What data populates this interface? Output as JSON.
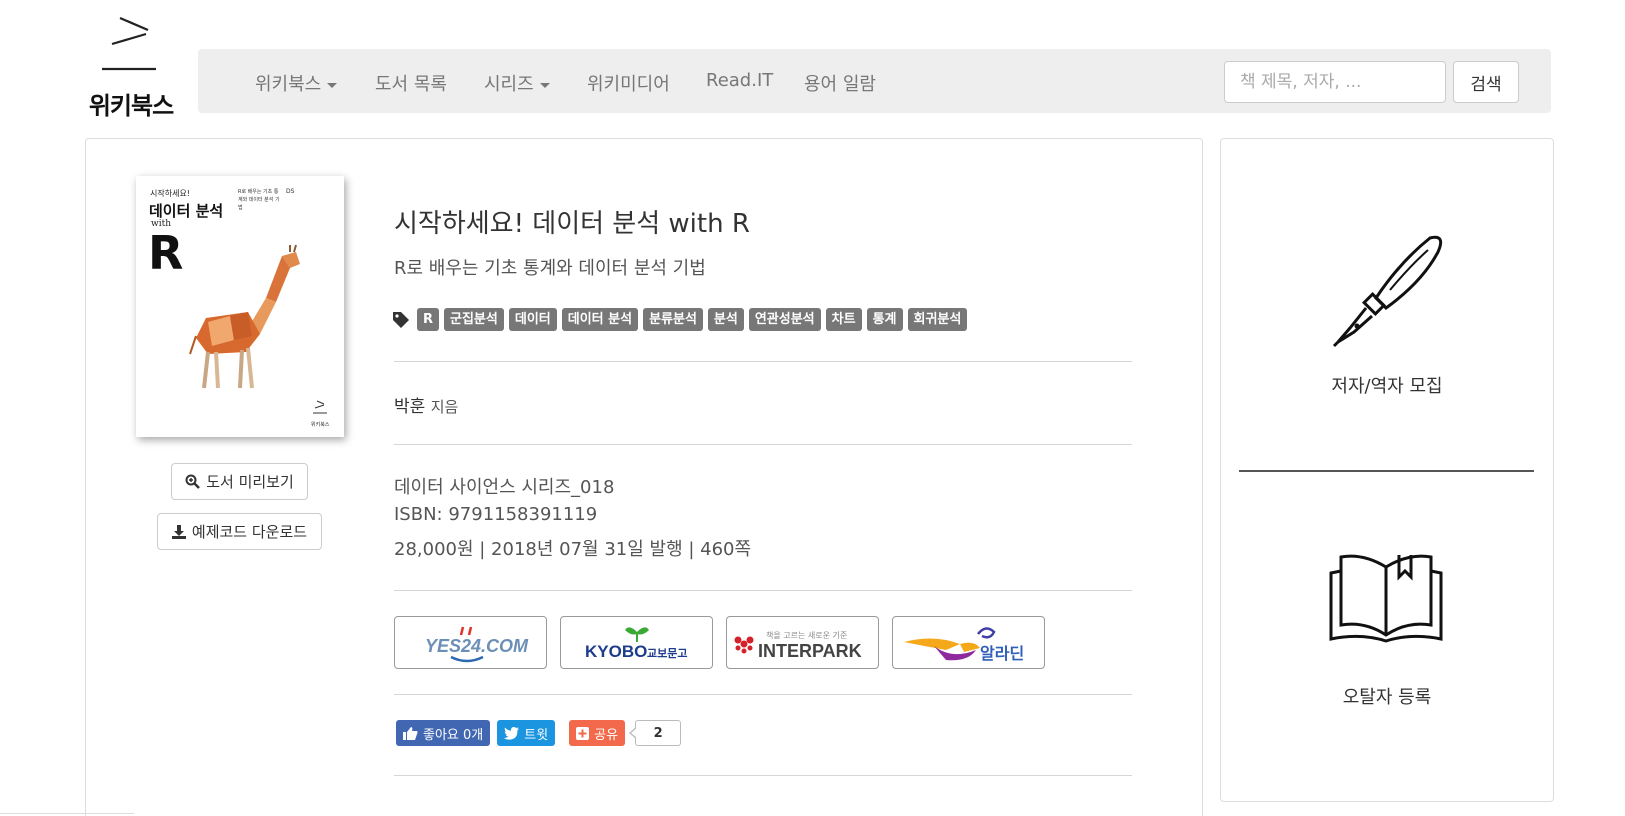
{
  "logo": {
    "text": "위키북스"
  },
  "nav": {
    "items": [
      {
        "label": "위키북스",
        "has_caret": true
      },
      {
        "label": "도서 목록",
        "has_caret": false
      },
      {
        "label": "시리즈",
        "has_caret": true
      },
      {
        "label": "위키미디어",
        "has_caret": false
      },
      {
        "label": "Read.IT",
        "has_caret": false
      },
      {
        "label": "용어 일람",
        "has_caret": false
      }
    ],
    "search_placeholder": "책 제목, 저자, ...",
    "search_button": "검색"
  },
  "cover": {
    "top_small": "시작하세요!",
    "title": "데이터 분석",
    "with": "with",
    "letter": "R",
    "blurb": "R로 배우는 기초 통계와 데이터 분석 기법",
    "series_mark": "DS",
    "publisher": "위키북스"
  },
  "buttons": {
    "preview": "도서 미리보기",
    "download": "예제코드 다운로드"
  },
  "book": {
    "title": "시작하세요! 데이터 분석 with R",
    "subtitle": "R로 배우는 기초 통계와 데이터 분석 기법",
    "tags": [
      "R",
      "군집분석",
      "데이터",
      "데이터 분석",
      "분류분석",
      "분석",
      "연관성분석",
      "차트",
      "통계",
      "회귀분석"
    ],
    "author": "박훈",
    "author_suffix": "지음",
    "series": "데이터 사이언스 시리즈_018",
    "isbn": "ISBN: 9791158391119",
    "price_line": "28,000원 | 2018년 07월 31일 발행 | 460쪽"
  },
  "stores": {
    "yes24": "YES24.COM",
    "kyobo_en": "KYOBO",
    "kyobo_ko": "교보문고",
    "interpark_tag": "책을 고르는 새로운 기준",
    "interpark": "INTERPARK",
    "aladin": "알라딘"
  },
  "social": {
    "like": "좋아요 0개",
    "tweet": "트윗",
    "share": "공유",
    "share_count": "2"
  },
  "side": {
    "recruit": "저자/역자 모집",
    "errata": "오탈자 등록"
  },
  "colors": {
    "tag_bg": "#777777",
    "facebook": "#4267b2",
    "twitter": "#1b95e0",
    "share": "#f26a4b",
    "navbar_bg": "#eeeeee"
  }
}
